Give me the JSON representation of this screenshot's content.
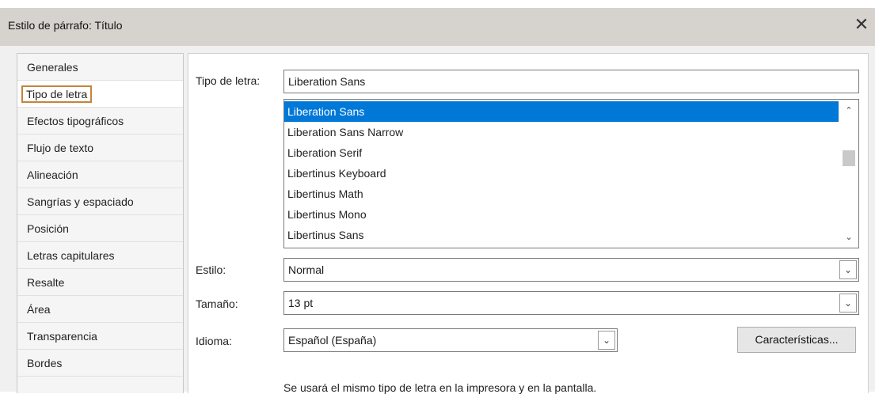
{
  "window": {
    "title": "Estilo de párrafo: Título",
    "close_glyph": "✕"
  },
  "sidebar": {
    "items": [
      {
        "label": "Generales"
      },
      {
        "label": "Tipo de letra",
        "selected": true
      },
      {
        "label": "Efectos tipográficos"
      },
      {
        "label": "Flujo de texto"
      },
      {
        "label": "Alineación"
      },
      {
        "label": "Sangrías y espaciado"
      },
      {
        "label": "Posición"
      },
      {
        "label": "Letras capitulares"
      },
      {
        "label": "Resalte"
      },
      {
        "label": "Área"
      },
      {
        "label": "Transparencia"
      },
      {
        "label": "Bordes"
      }
    ]
  },
  "font": {
    "label": "Tipo de letra:",
    "value": "Liberation Sans",
    "list": [
      "Liberation Sans",
      "Liberation Sans Narrow",
      "Liberation Serif",
      "Libertinus Keyboard",
      "Libertinus Math",
      "Libertinus Mono",
      "Libertinus Sans"
    ],
    "selected_index": 0
  },
  "style": {
    "label": "Estilo:",
    "value": "Normal"
  },
  "size": {
    "label": "Tamaño:",
    "value": "13 pt"
  },
  "language": {
    "label": "Idioma:",
    "value": "Español (España)"
  },
  "features_button": "Características...",
  "note": "Se usará el mismo tipo de letra en la impresora y en la pantalla.",
  "colors": {
    "accent": "#0078d7",
    "selection_outline": "#c4843c",
    "titlebar": "#d6d3cf"
  }
}
